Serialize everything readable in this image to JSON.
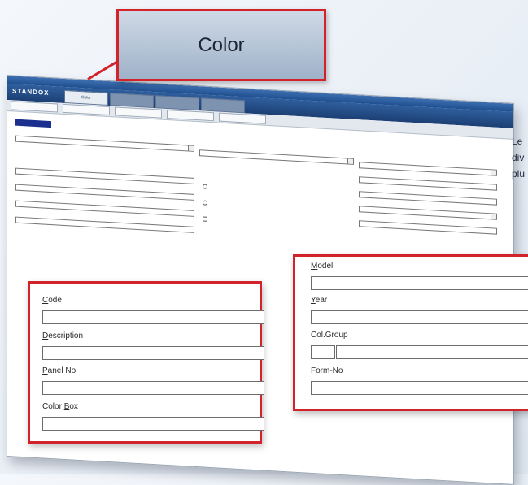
{
  "callout": {
    "label": "Color"
  },
  "app": {
    "logo": "STANDOX",
    "tabs": [
      {
        "label": "Color",
        "active": true
      },
      {
        "label": "",
        "active": false
      },
      {
        "label": "",
        "active": false
      },
      {
        "label": "",
        "active": false
      }
    ],
    "form_selected_value": ""
  },
  "zoom_left": {
    "fields": [
      {
        "label_prefix": "",
        "label_ul": "C",
        "label_rest": "ode"
      },
      {
        "label_prefix": "",
        "label_ul": "D",
        "label_rest": "escription"
      },
      {
        "label_prefix": "",
        "label_ul": "P",
        "label_rest": "anel No"
      },
      {
        "label_prefix": "Color ",
        "label_ul": "B",
        "label_rest": "ox"
      }
    ]
  },
  "zoom_right": {
    "fields": [
      {
        "label_prefix": "",
        "label_ul": "M",
        "label_rest": "odel"
      },
      {
        "label_prefix": "",
        "label_ul": "Y",
        "label_rest": "ear"
      },
      {
        "label_prefix": "Col.Group",
        "label_ul": "",
        "label_rest": ""
      },
      {
        "label_prefix": "Form-No",
        "label_ul": "",
        "label_rest": ""
      }
    ]
  },
  "side_text": {
    "lines": [
      "Le",
      "div",
      "plu"
    ]
  },
  "colors": {
    "accent_red": "#d2232a",
    "brand_blue": "#1c3f73"
  }
}
